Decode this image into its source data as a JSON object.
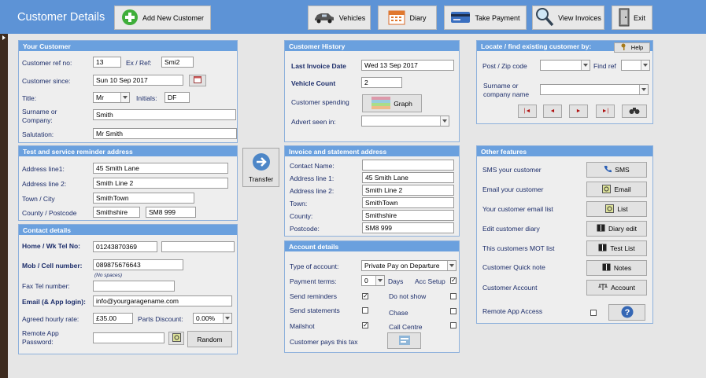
{
  "header": {
    "title": "Customer Details",
    "add_customer": "Add New Customer",
    "vehicles": "Vehicles",
    "diary": "Diary",
    "take_payment": "Take Payment",
    "view_invoices": "View Invoices",
    "exit": "Exit"
  },
  "your_customer": {
    "title": "Your Customer",
    "ref_label": "Customer ref no:",
    "ref_value": "13",
    "exref_label": "Ex / Ref:",
    "exref_value": "Smi2",
    "since_label": "Customer since:",
    "since_value": "Sun 10 Sep 2017",
    "title_label": "Title:",
    "title_value": "Mr",
    "initials_label": "Initials:",
    "initials_value": "DF",
    "surname_label1": "Surname  or",
    "surname_label2": "Company:",
    "surname_value": "Smith",
    "salutation_label": "Salutation:",
    "salutation_value": "Mr Smith"
  },
  "reminder_address": {
    "title": "Test and service reminder address",
    "line1_label": "Address line1:",
    "line1_value": "45 Smith Lane",
    "line2_label": "Address line 2:",
    "line2_value": "Smith Line 2",
    "town_label": "Town / City",
    "town_value": "SmithTown",
    "county_label": "County / Postcode",
    "county_value": "Smithshire",
    "postcode_value": "SM8 999"
  },
  "contact": {
    "title": "Contact details",
    "home_label": "Home / Wk Tel No:",
    "home_value": "01243870369",
    "mob_label": "Mob / Cell number:",
    "mob_value": "089875676643",
    "mob_hint": "(No spaces)",
    "fax_label": "Fax Tel number:",
    "email_label": "Email (& App login):",
    "email_value": "info@yourgaragename.com",
    "rate_label": "Agreed hourly rate:",
    "rate_value": "£35.00",
    "discount_label": "Parts Discount:",
    "discount_value": "0.00%",
    "app_pw_label1": "Remote App",
    "app_pw_label2": "Password:",
    "random_btn": "Random"
  },
  "transfer": {
    "label": "Transfer"
  },
  "history": {
    "title": "Customer History",
    "last_invoice_label": "Last Invoice Date",
    "last_invoice_value": "Wed 13 Sep 2017",
    "vehicle_count_label": "Vehicle Count",
    "vehicle_count_value": "2",
    "spending_label": "Customer spending",
    "graph_btn": "Graph",
    "advert_label": "Advert seen in:"
  },
  "invoice_address": {
    "title": "Invoice and statement address",
    "contact_label": "Contact Name:",
    "line1_label": "Address line 1:",
    "line1_value": "45 Smith Lane",
    "line2_label": "Address line 2:",
    "line2_value": "Smith Line 2",
    "town_label": "Town:",
    "town_value": "SmithTown",
    "county_label": "County:",
    "county_value": "Smithshire",
    "postcode_label": "Postcode:",
    "postcode_value": "SM8 999"
  },
  "account": {
    "title": "Account details",
    "type_label": "Type of account:",
    "type_value": "Private Pay on Departure",
    "terms_label": "Payment terms:",
    "terms_value": "0",
    "days_label": "Days",
    "acc_setup_label": "Acc Setup",
    "send_reminders": "Send reminders",
    "do_not_show": "Do not show",
    "send_statements": "Send statements",
    "chase": "Chase",
    "mailshot": "Mailshot",
    "call_centre": "Call Centre",
    "pays_tax": "Customer pays this tax"
  },
  "locate": {
    "title": "Locate / find existing customer by:",
    "help_btn": "Help",
    "post_label": "Post / Zip code",
    "find_ref_label": "Find ref",
    "surname_label1": "Surname  or",
    "surname_label2": "company name"
  },
  "features": {
    "title": "Other features",
    "sms_label": "SMS your customer",
    "sms_btn": "SMS",
    "email_label": "Email your customer",
    "email_btn": "Email",
    "list_label": "Your customer email list",
    "list_btn": "List",
    "diary_label": "Edit customer diary",
    "diary_btn": "Diary edit",
    "mot_label": "This customers     MOT   list",
    "mot_btn": "Test List",
    "note_label": "Customer Quick note",
    "note_btn": "Notes",
    "account_label": "Customer Account",
    "account_btn": "Account",
    "remote_label": "Remote App Access"
  },
  "colors": {
    "header_bg": "#5d93d6",
    "panel_header": "#6aa0de",
    "label_text": "#1c2d6a"
  }
}
